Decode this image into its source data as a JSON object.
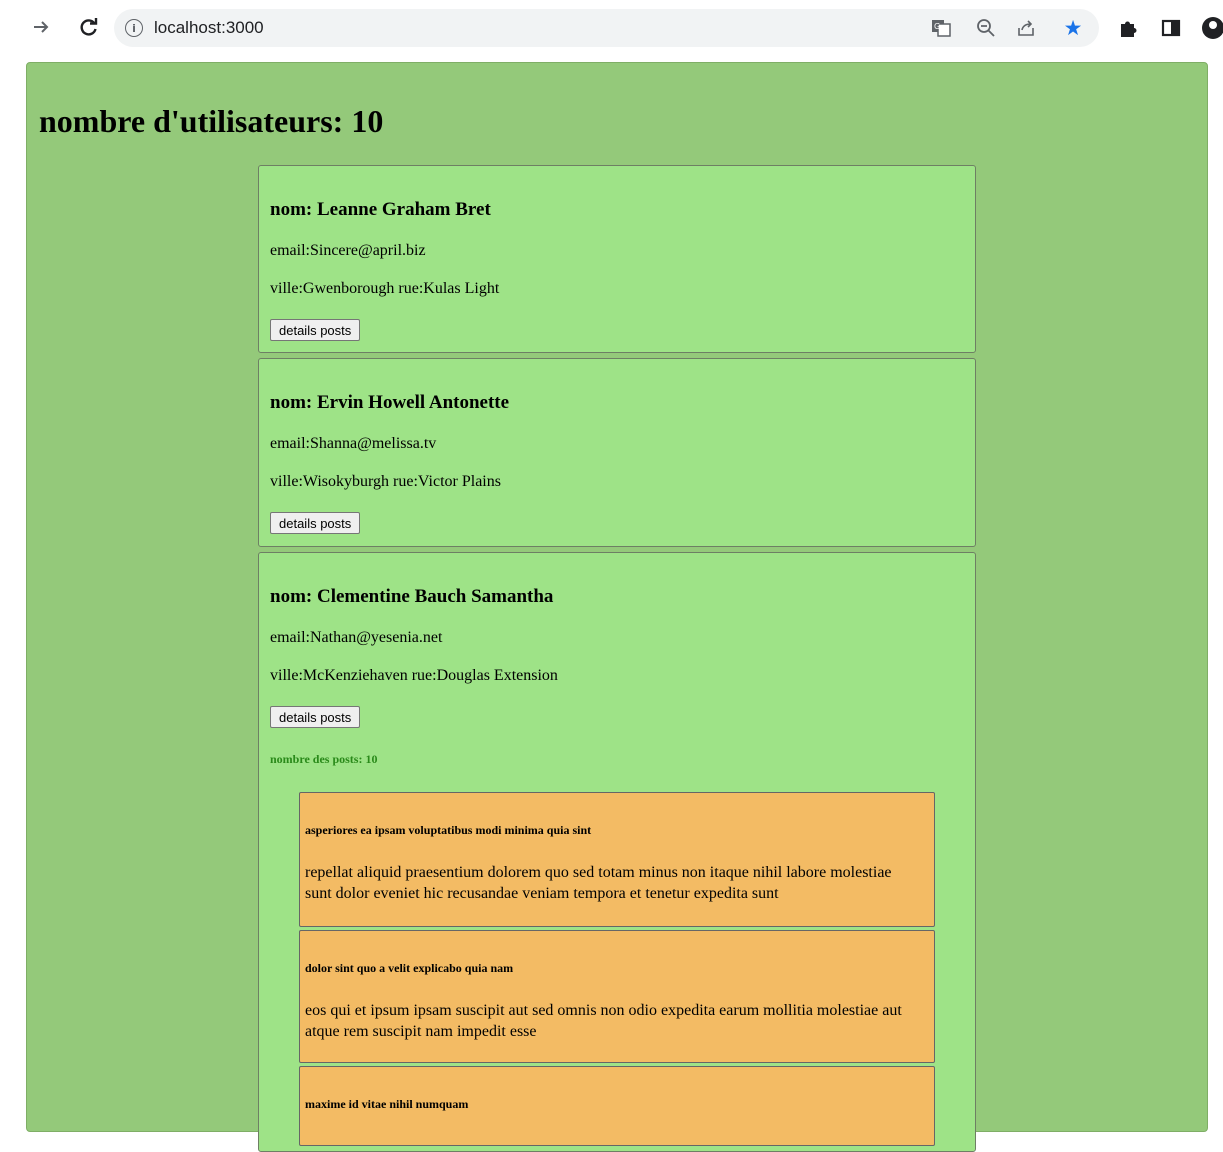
{
  "browser": {
    "url": "localhost:3000",
    "icons": [
      "forward-icon",
      "reload-icon",
      "info-icon",
      "translate-icon",
      "zoom-icon",
      "share-icon",
      "bookmark-star-icon",
      "extensions-icon",
      "side-panel-icon",
      "profile-icon"
    ]
  },
  "page": {
    "title": "nombre d'utilisateurs: 10",
    "users": [
      {
        "name": "nom: Leanne Graham Bret",
        "email": "email:Sincere@april.biz",
        "address": "ville:Gwenborough rue:Kulas Light",
        "button": "details posts"
      },
      {
        "name": "nom: Ervin Howell Antonette",
        "email": "email:Shanna@melissa.tv",
        "address": "ville:Wisokyburgh rue:Victor Plains",
        "button": "details posts"
      },
      {
        "name": "nom: Clementine Bauch Samantha",
        "email": "email:Nathan@yesenia.net",
        "address": "ville:McKenziehaven rue:Douglas Extension",
        "button": "details posts",
        "posts_count": "nombre des posts: 10",
        "posts": [
          {
            "title": "asperiores ea ipsam voluptatibus modi minima quia sint",
            "body": "repellat aliquid praesentium dolorem quo sed totam minus non itaque nihil labore molestiae sunt dolor eveniet hic recusandae veniam tempora et tenetur expedita sunt"
          },
          {
            "title": "dolor sint quo a velit explicabo quia nam",
            "body": "eos qui et ipsum ipsam suscipit aut sed omnis non odio expedita earum mollitia molestiae aut atque rem suscipit nam impedit esse"
          },
          {
            "title": "maxime id vitae nihil numquam",
            "body": ""
          }
        ]
      }
    ]
  }
}
